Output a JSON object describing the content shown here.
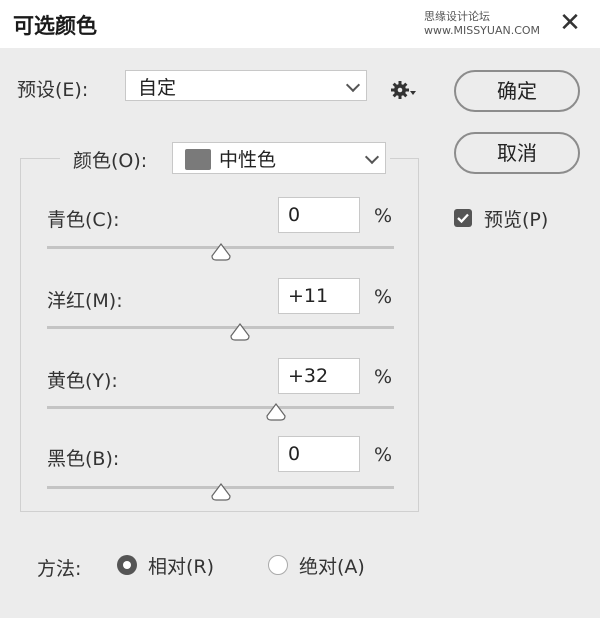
{
  "window": {
    "title": "可选颜色",
    "watermark": "思缘设计论坛  www.MISSYUAN.COM",
    "close_glyph": "✕"
  },
  "preset": {
    "label": "预设(E):",
    "value": "自定",
    "menu_icon": "gear-icon"
  },
  "buttons": {
    "ok": "确定",
    "cancel": "取消"
  },
  "preview": {
    "label": "预览(P)",
    "checked": true
  },
  "colors": {
    "label": "颜色(O):",
    "value": "中性色",
    "swatch_color": "#7a7a7a"
  },
  "sliders": [
    {
      "label": "青色(C):",
      "value": "0",
      "unit": "%",
      "position_fraction": 0.5
    },
    {
      "label": "洋红(M):",
      "value": "+11",
      "unit": "%",
      "position_fraction": 0.555
    },
    {
      "label": "黄色(Y):",
      "value": "+32",
      "unit": "%",
      "position_fraction": 0.66
    },
    {
      "label": "黑色(B):",
      "value": "0",
      "unit": "%",
      "position_fraction": 0.5
    }
  ],
  "method": {
    "label": "方法:",
    "options": [
      {
        "label": "相对(R)",
        "selected": true
      },
      {
        "label": "绝对(A)",
        "selected": false
      }
    ]
  }
}
